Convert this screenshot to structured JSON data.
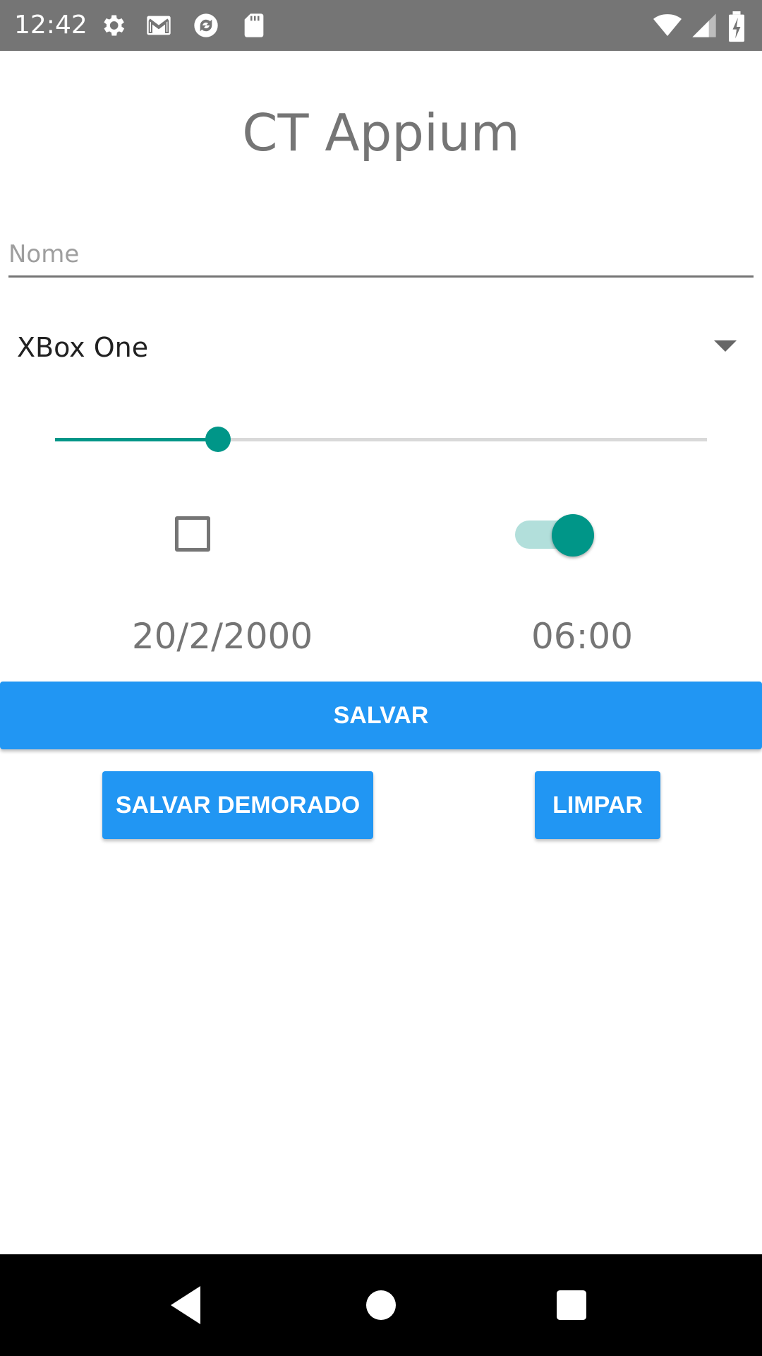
{
  "status_bar": {
    "time": "12:42",
    "icons": [
      "settings-gear-icon",
      "gmail-icon",
      "sync-app-icon",
      "sd-card-icon",
      "wifi-icon",
      "cell-signal-icon",
      "battery-charging-icon"
    ]
  },
  "app": {
    "title": "CT Appium"
  },
  "form": {
    "name_placeholder": "Nome",
    "name_value": "",
    "console_selected": "XBox One",
    "slider_value_fraction": 0.25,
    "checkbox_checked": false,
    "switch_on": true,
    "date": "20/2/2000",
    "time": "06:00"
  },
  "buttons": {
    "save": "SALVAR",
    "save_delayed": "SALVAR DEMORADO",
    "clear": "LIMPAR"
  },
  "nav_bar": {
    "icons": [
      "back-icon",
      "home-icon",
      "recents-icon"
    ]
  },
  "colors": {
    "accent": "#009688",
    "accent_light": "#b2dfdb",
    "button": "#2196f3",
    "status_bar": "#757575",
    "nav_bar": "#000000"
  }
}
